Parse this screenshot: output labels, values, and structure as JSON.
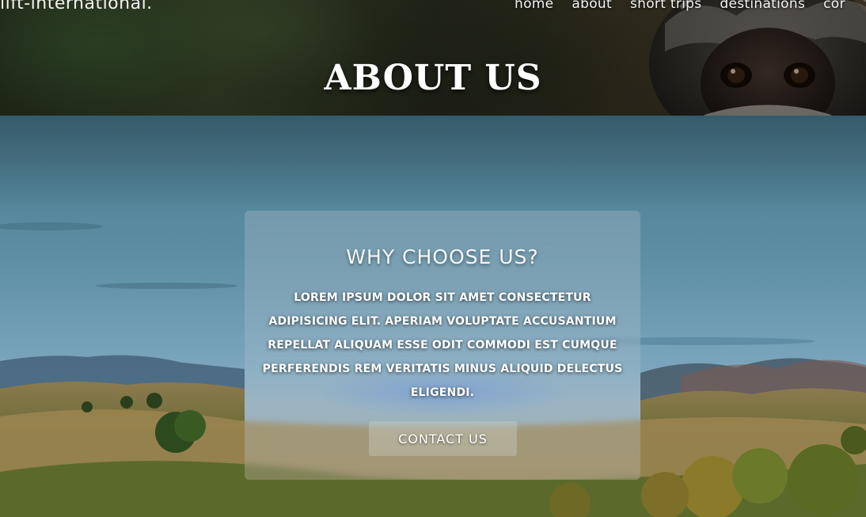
{
  "header": {
    "brand": "lift-international.",
    "nav": [
      {
        "label": "home"
      },
      {
        "label": "about"
      },
      {
        "label": "short trips"
      },
      {
        "label": "destinations"
      },
      {
        "label": "cor"
      }
    ],
    "page_title": "ABOUT US"
  },
  "card": {
    "title": "WHY CHOOSE US?",
    "text": "Lorem ipsum dolor sit amet consectetur adipisicing elit. Aperiam voluptate accusantium repellat aliquam esse odit commodi est cumque perferendis rem veritatis minus aliquid delectus eligendi.",
    "button_label": "CONTACT US"
  }
}
